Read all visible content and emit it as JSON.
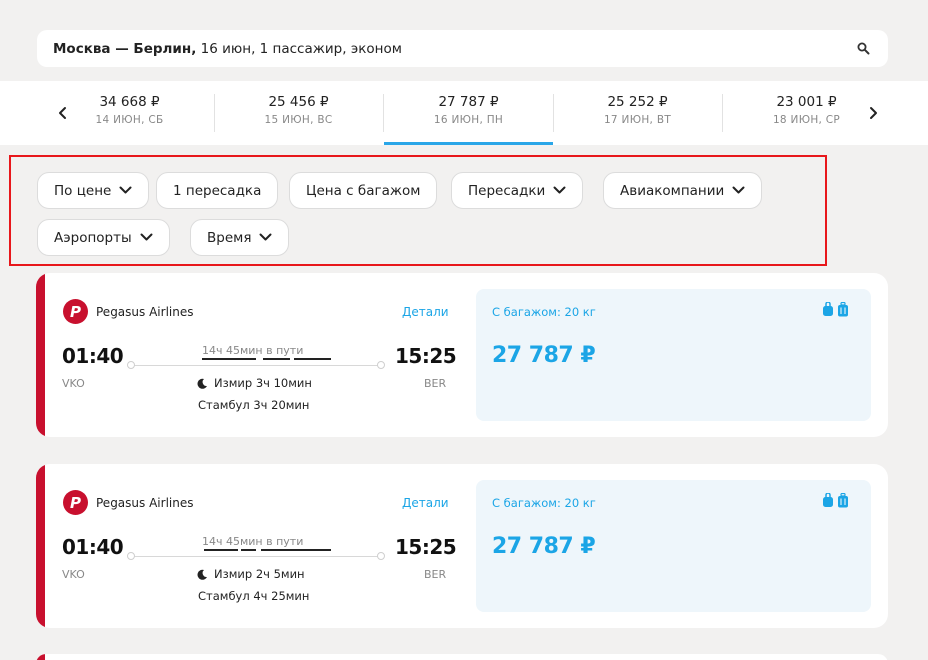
{
  "search": {
    "route": "Москва — Берлин,",
    "params": " 16 июн, 1 пассажир, эконом"
  },
  "dates": [
    {
      "price": "34 668 ₽",
      "day": "14 ИЮН, СБ"
    },
    {
      "price": "25 456 ₽",
      "day": "15 ИЮН, ВС"
    },
    {
      "price": "27 787 ₽",
      "day": "16 ИЮН, ПН",
      "selected": true
    },
    {
      "price": "25 252 ₽",
      "day": "17 ИЮН, ВТ"
    },
    {
      "price": "23 001 ₽",
      "day": "18 ИЮН, СР"
    }
  ],
  "filters": {
    "sort": "По цене",
    "one_stop": "1 пересадка",
    "with_baggage": "Цена с багажом",
    "transfers": "Пересадки",
    "airlines": "Авиакомпании",
    "airports": "Аэропорты",
    "time": "Время"
  },
  "flights": [
    {
      "airline": "Pegasus Airlines",
      "details": "Детали",
      "dep_time": "01:40",
      "dep_code": "VKO",
      "arr_time": "15:25",
      "arr_code": "BER",
      "duration": "14ч 45мин в пути",
      "stop1": "Измир 3ч 10мин",
      "stop2": "Стамбул 3ч 20мин",
      "baggage": "С багажом: 20 кг",
      "price": "27 787 ₽"
    },
    {
      "airline": "Pegasus Airlines",
      "details": "Детали",
      "dep_time": "01:40",
      "dep_code": "VKO",
      "arr_time": "15:25",
      "arr_code": "BER",
      "duration": "14ч 45мин в пути",
      "stop1": "Измир 2ч 5мин",
      "stop2": "Стамбул 4ч 25мин",
      "baggage": "С багажом: 20 кг",
      "price": "27 787 ₽"
    }
  ],
  "colors": {
    "accent": "#1ba5e6",
    "airline_brand": "#c8102e",
    "highlight_box": "#e8171b"
  },
  "icons": {
    "search": "search-icon",
    "prev": "chevron-left-icon",
    "next": "chevron-right-icon",
    "dropdown": "chevron-down-icon",
    "night": "moon-icon",
    "hand_luggage": "hand-luggage-icon",
    "suitcase": "suitcase-icon"
  }
}
